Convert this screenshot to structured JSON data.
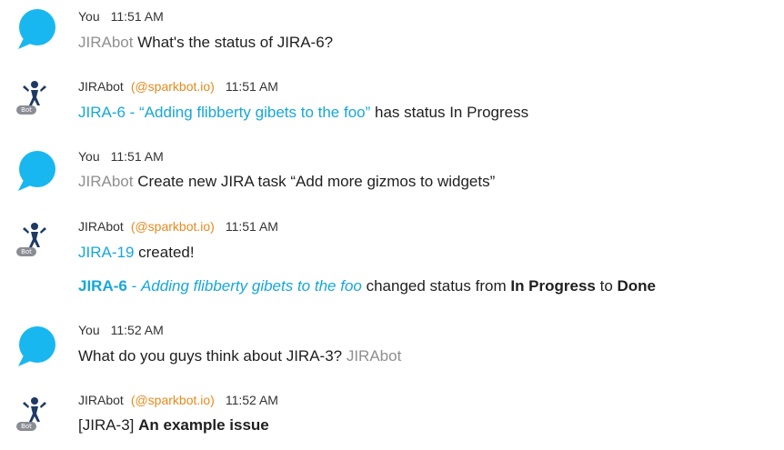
{
  "colors": {
    "you_avatar": "#18b7f0",
    "link": "#16a7d9",
    "handle": "#e8891c",
    "mention": "#8f8f8f",
    "bot_badge": "#8a8d94",
    "bot_figure": "#1e3a63"
  },
  "icons": {
    "you_avatar": "speech-bubble-icon",
    "bot_avatar": "bot-mascot-icon"
  },
  "messages": [
    {
      "author": "You",
      "time": "11:51 AM",
      "mention": "JIRAbot",
      "text": " What's the status of JIRA-6?"
    },
    {
      "author": "JIRAbot",
      "handle": "(@sparkbot.io)",
      "time": "11:51 AM",
      "badge": "Bot",
      "link": "JIRA-6 - “Adding flibberty gibets to the foo”",
      "text": " has status In Progress"
    },
    {
      "author": "You",
      "time": "11:51 AM",
      "mention": "JIRAbot",
      "text": " Create new JIRA task “Add more gizmos to widgets”"
    },
    {
      "author": "JIRAbot",
      "handle": "(@sparkbot.io)",
      "time": "11:51 AM",
      "badge": "Bot",
      "link": "JIRA-19",
      "text": " created!",
      "followup": {
        "issue_key": "JIRA-6",
        "separator": " - ",
        "issue_title": "Adding flibberty gibets to the foo",
        "text_before": " changed status from ",
        "from_status": "In Progress",
        "text_middle": " to ",
        "to_status": "Done"
      }
    },
    {
      "author": "You",
      "time": "11:52 AM",
      "text": "What do you guys think about JIRA-3? ",
      "mention": "JIRAbot"
    },
    {
      "author": "JIRAbot",
      "handle": "(@sparkbot.io)",
      "time": "11:52 AM",
      "badge": "Bot",
      "prefix": "[JIRA-3] ",
      "bold": "An example issue"
    }
  ]
}
